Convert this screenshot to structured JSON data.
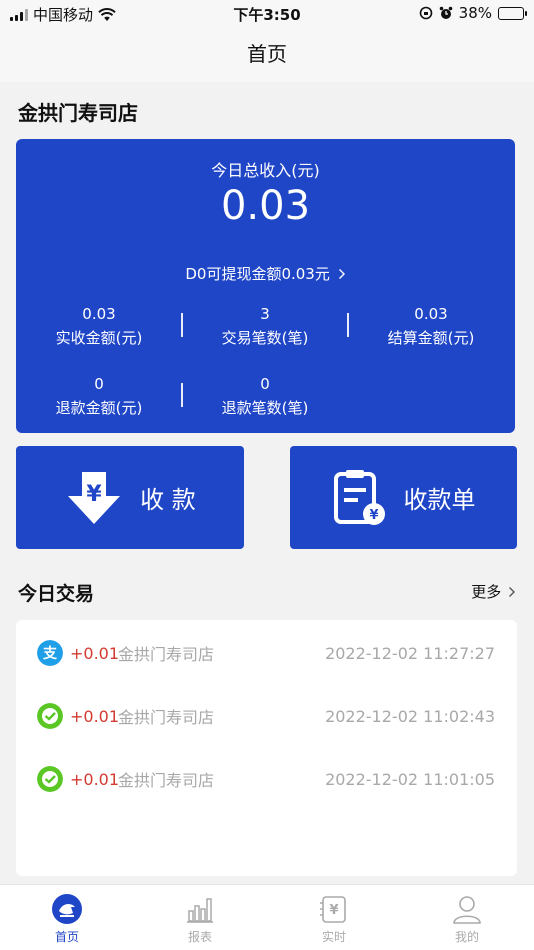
{
  "status_bar": {
    "carrier": "中国移动",
    "time": "下午3:50",
    "battery": "38%",
    "battery_level": 0.38
  },
  "nav": {
    "title": "首页"
  },
  "shop": {
    "name": "金拱门寿司店"
  },
  "summary": {
    "income_label": "今日总收入(元)",
    "income_value": "0.03",
    "withdraw_text": "D0可提现金额0.03元",
    "stats": [
      {
        "value": "0.03",
        "label": "实收金额(元)"
      },
      {
        "value": "3",
        "label": "交易笔数(笔)"
      },
      {
        "value": "0.03",
        "label": "结算金额(元)"
      },
      {
        "value": "0",
        "label": "退款金额(元)"
      },
      {
        "value": "0",
        "label": "退款笔数(笔)"
      }
    ]
  },
  "actions": {
    "collect_label": "收 款",
    "receipt_label": "收款单"
  },
  "today": {
    "title": "今日交易",
    "more_label": "更多"
  },
  "transactions": [
    {
      "method": "alipay",
      "amount": "+0.01",
      "merchant": "金拱门寿司店",
      "datetime": "2022-12-02 11:27:27"
    },
    {
      "method": "wechat",
      "amount": "+0.01",
      "merchant": "金拱门寿司店",
      "datetime": "2022-12-02 11:02:43"
    },
    {
      "method": "wechat",
      "amount": "+0.01",
      "merchant": "金拱门寿司店",
      "datetime": "2022-12-02 11:01:05"
    }
  ],
  "tabs": [
    {
      "label": "首页",
      "icon": "home-icon"
    },
    {
      "label": "报表",
      "icon": "report-icon"
    },
    {
      "label": "实时",
      "icon": "realtime-icon"
    },
    {
      "label": "我的",
      "icon": "profile-icon"
    }
  ],
  "colors": {
    "primary": "#2046c8",
    "amount": "#d33a31",
    "alipay": "#1e9fe8",
    "wechat": "#5ac725"
  }
}
